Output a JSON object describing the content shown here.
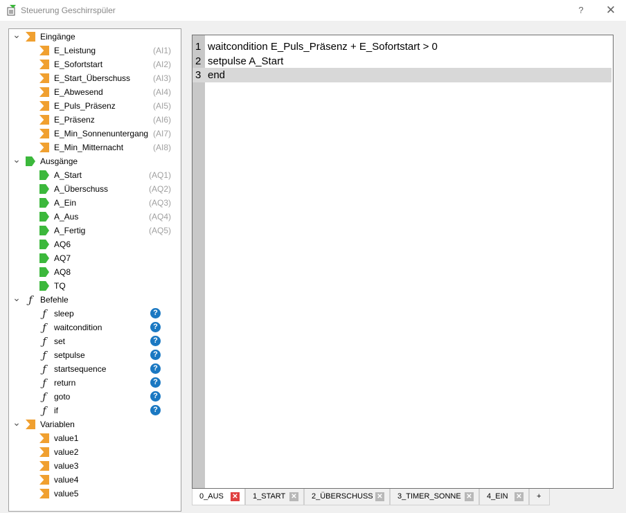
{
  "window": {
    "title": "Steuerung Geschirrspüler",
    "help": "?",
    "close": "✕"
  },
  "tree": [
    {
      "type": "group",
      "icon": "in",
      "label": "Eingänge"
    },
    {
      "type": "item",
      "icon": "in",
      "label": "E_Leistung",
      "alias": "(AI1)"
    },
    {
      "type": "item",
      "icon": "in",
      "label": "E_Sofortstart",
      "alias": "(AI2)"
    },
    {
      "type": "item",
      "icon": "in",
      "label": "E_Start_Überschuss",
      "alias": "(AI3)"
    },
    {
      "type": "item",
      "icon": "in",
      "label": "E_Abwesend",
      "alias": "(AI4)"
    },
    {
      "type": "item",
      "icon": "in",
      "label": "E_Puls_Präsenz",
      "alias": "(AI5)"
    },
    {
      "type": "item",
      "icon": "in",
      "label": "E_Präsenz",
      "alias": "(AI6)"
    },
    {
      "type": "item",
      "icon": "in",
      "label": "E_Min_Sonnenuntergang",
      "alias": "(AI7)"
    },
    {
      "type": "item",
      "icon": "in",
      "label": "E_Min_Mitternacht",
      "alias": "(AI8)"
    },
    {
      "type": "group",
      "icon": "out",
      "label": "Ausgänge"
    },
    {
      "type": "item",
      "icon": "out",
      "label": "A_Start",
      "alias": "(AQ1)"
    },
    {
      "type": "item",
      "icon": "out",
      "label": "A_Überschuss",
      "alias": "(AQ2)"
    },
    {
      "type": "item",
      "icon": "out",
      "label": "A_Ein",
      "alias": "(AQ3)"
    },
    {
      "type": "item",
      "icon": "out",
      "label": "A_Aus",
      "alias": "(AQ4)"
    },
    {
      "type": "item",
      "icon": "out",
      "label": "A_Fertig",
      "alias": "(AQ5)"
    },
    {
      "type": "item",
      "icon": "out",
      "label": "AQ6",
      "alias": ""
    },
    {
      "type": "item",
      "icon": "out",
      "label": "AQ7",
      "alias": ""
    },
    {
      "type": "item",
      "icon": "out",
      "label": "AQ8",
      "alias": ""
    },
    {
      "type": "item",
      "icon": "out",
      "label": "TQ",
      "alias": ""
    },
    {
      "type": "group",
      "icon": "func",
      "label": "Befehle"
    },
    {
      "type": "item",
      "icon": "func",
      "label": "sleep",
      "help": "?"
    },
    {
      "type": "item",
      "icon": "func",
      "label": "waitcondition",
      "help": "?"
    },
    {
      "type": "item",
      "icon": "func",
      "label": "set",
      "help": "?"
    },
    {
      "type": "item",
      "icon": "func",
      "label": "setpulse",
      "help": "?"
    },
    {
      "type": "item",
      "icon": "func",
      "label": "startsequence",
      "help": "?"
    },
    {
      "type": "item",
      "icon": "func",
      "label": "return",
      "help": "?"
    },
    {
      "type": "item",
      "icon": "func",
      "label": "goto",
      "help": "?"
    },
    {
      "type": "item",
      "icon": "func",
      "label": "if",
      "help": "?"
    },
    {
      "type": "group",
      "icon": "in",
      "label": "Variablen"
    },
    {
      "type": "item",
      "icon": "in",
      "label": "value1"
    },
    {
      "type": "item",
      "icon": "in",
      "label": "value2"
    },
    {
      "type": "item",
      "icon": "in",
      "label": "value3"
    },
    {
      "type": "item",
      "icon": "in",
      "label": "value4"
    },
    {
      "type": "item",
      "icon": "in",
      "label": "value5"
    }
  ],
  "editor": {
    "lines": [
      {
        "n": "1",
        "text": "waitcondition E_Puls_Präsenz + E_Sofortstart > 0"
      },
      {
        "n": "2",
        "text": "setpulse A_Start"
      },
      {
        "n": "3",
        "text": "end"
      }
    ],
    "current_line": 3
  },
  "tabs": [
    {
      "label": "0_AUS",
      "close": "✕",
      "active": true
    },
    {
      "label": "1_START",
      "close": "✕"
    },
    {
      "label": "2_ÜBERSCHUSS",
      "close": "✕"
    },
    {
      "label": "3_TIMER_SONNE",
      "close": "✕"
    },
    {
      "label": "4_EIN",
      "close": "✕"
    },
    {
      "label": "+"
    }
  ],
  "colors": {
    "input_icon": "#f0a030",
    "output_icon": "#3cb83c",
    "help_badge": "#1a78c2",
    "active_tab_close": "#e04040"
  }
}
